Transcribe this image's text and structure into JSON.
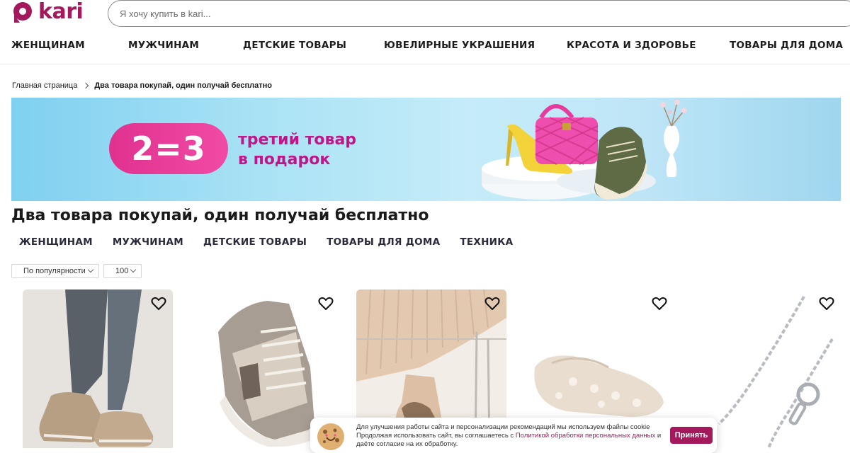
{
  "header": {
    "logo_text": "kari",
    "search_placeholder": "Я хочу купить в kari..."
  },
  "main_nav": [
    {
      "label": "ЖЕНЩИНАМ"
    },
    {
      "label": "МУЖЧИНАМ"
    },
    {
      "label": "ДЕТСКИЕ ТОВАРЫ"
    },
    {
      "label": "ЮВЕЛИРНЫЕ УКРАШЕНИЯ"
    },
    {
      "label": "КРАСОТА И ЗДОРОВЬЕ"
    },
    {
      "label": "ТОВАРЫ ДЛЯ ДОМА"
    }
  ],
  "breadcrumb": {
    "home": "Главная страница",
    "current": "Два товара покупай, один получай бесплатно"
  },
  "banner": {
    "badge": "2=3",
    "line1": "третий товар",
    "line2": "в подарок"
  },
  "page_title": "Два товара покупай, один получай бесплатно",
  "categories": [
    {
      "label": "ЖЕНЩИНАМ"
    },
    {
      "label": "МУЖЧИНАМ"
    },
    {
      "label": "ДЕТСКИЕ ТОВАРЫ"
    },
    {
      "label": "ТОВАРЫ ДЛЯ ДОМА"
    },
    {
      "label": "ТЕХНИКА"
    }
  ],
  "filters": {
    "sort": "По популярности",
    "per_page": "100"
  },
  "products": [
    {
      "image": "sneakers-on-model"
    },
    {
      "image": "grey-sneaker"
    },
    {
      "image": "lace-up-shoes-on-model"
    },
    {
      "image": "lace-ballet-flats"
    },
    {
      "image": "silver-chain"
    }
  ],
  "cookie": {
    "text_before": "Для улучшения работы сайта и персонализации рекомендаций мы используем файлы cookie Продолжая использовать сайт, вы соглашаетесь с ",
    "link": "Политикой обработки персональных данных",
    "text_after": " и даёте согласие на их обработку.",
    "accept_label": "Принять"
  },
  "colors": {
    "brand": "#a3195b",
    "promo_pink": "#e0318f"
  }
}
